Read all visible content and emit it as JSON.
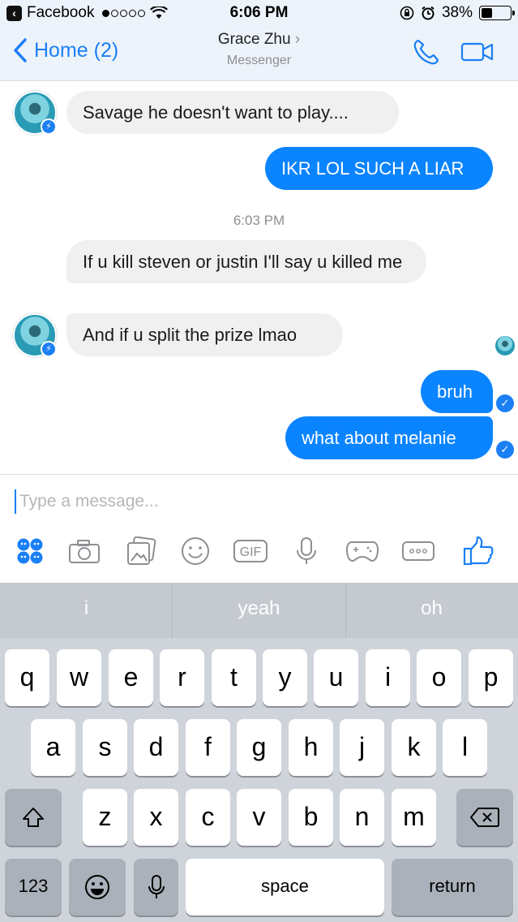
{
  "status_bar": {
    "app_back": "Facebook",
    "time": "6:06 PM",
    "battery": "38%",
    "battery_level": 0.38
  },
  "header": {
    "back_label": "Home (2)",
    "title": "Grace Zhu",
    "title_chevron": "›",
    "subtitle": "Messenger"
  },
  "messages": [
    {
      "from": "them",
      "text": "Savage he doesn't want to play...."
    },
    {
      "from": "me",
      "text": "IKR LOL SUCH A LIAR"
    },
    {
      "timestamp": "6:03 PM"
    },
    {
      "from": "them",
      "text": "If u kill steven or justin I'll say u killed me"
    },
    {
      "from": "them",
      "text": "And if u split the prize lmao"
    },
    {
      "from": "me",
      "text": "bruh"
    },
    {
      "from": "me",
      "text": "what about melanie"
    }
  ],
  "composer": {
    "placeholder": "Type a message...",
    "tools": [
      "apps-icon",
      "camera-icon",
      "photo-gallery-icon",
      "emoji-icon",
      "gif-icon",
      "microphone-icon",
      "games-icon",
      "more-icon",
      "like-icon"
    ],
    "gif_label": "GIF"
  },
  "keyboard": {
    "suggestions": [
      "i",
      "yeah",
      "oh"
    ],
    "row1": [
      "q",
      "w",
      "e",
      "r",
      "t",
      "y",
      "u",
      "i",
      "o",
      "p"
    ],
    "row2": [
      "a",
      "s",
      "d",
      "f",
      "g",
      "h",
      "j",
      "k",
      "l"
    ],
    "row3": [
      "z",
      "x",
      "c",
      "v",
      "b",
      "n",
      "m"
    ],
    "numbers_label": "123",
    "space_label": "space",
    "return_label": "return"
  },
  "colors": {
    "accent": "#1b7ff5",
    "outgoing_bubble": "#0b84ff",
    "incoming_bubble": "#f1f0f0",
    "header_bg": "#edf3fb"
  }
}
